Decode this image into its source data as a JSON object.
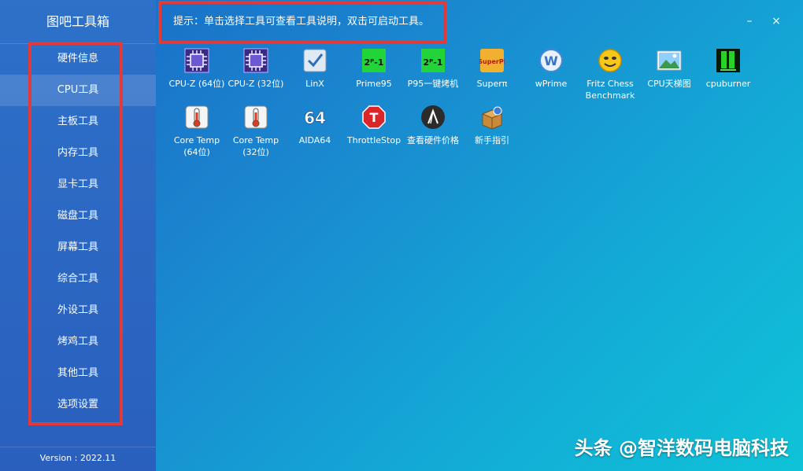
{
  "app": {
    "title": "图吧工具箱",
    "version": "Version : 2022.11"
  },
  "sidebar": {
    "items": [
      {
        "label": "硬件信息"
      },
      {
        "label": "CPU工具"
      },
      {
        "label": "主板工具"
      },
      {
        "label": "内存工具"
      },
      {
        "label": "显卡工具"
      },
      {
        "label": "磁盘工具"
      },
      {
        "label": "屏幕工具"
      },
      {
        "label": "综合工具"
      },
      {
        "label": "外设工具"
      },
      {
        "label": "烤鸡工具"
      },
      {
        "label": "其他工具"
      },
      {
        "label": "选项设置"
      }
    ],
    "active": "CPU工具"
  },
  "tip": {
    "text": "提示：单击选择工具可查看工具说明，双击可启动工具。"
  },
  "window": {
    "minimize_label": "–",
    "close_label": "×"
  },
  "tools": {
    "row1": [
      {
        "label": "CPU-Z (64位)",
        "icon": "cpu-chip-icon"
      },
      {
        "label": "CPU-Z (32位)",
        "icon": "cpu-chip-icon"
      },
      {
        "label": "LinX",
        "icon": "checkmark-icon"
      },
      {
        "label": "Prime95",
        "icon": "prime95-icon"
      },
      {
        "label": "P95一键烤机",
        "icon": "prime95-icon"
      },
      {
        "label": "Superπ",
        "icon": "superpi-icon"
      },
      {
        "label": "wPrime",
        "icon": "wprime-icon"
      },
      {
        "label": "Fritz Chess Benchmark",
        "icon": "smiley-face-icon"
      },
      {
        "label": "CPU天梯图",
        "icon": "landscape-image-icon"
      },
      {
        "label": "cpuburner",
        "icon": "cpuburner-icon"
      }
    ],
    "row2": [
      {
        "label": "Core Temp (64位)",
        "icon": "thermometer-icon"
      },
      {
        "label": "Core Temp (32位)",
        "icon": "thermometer-icon"
      },
      {
        "label": "AIDA64",
        "icon": "aida64-icon"
      },
      {
        "label": "ThrottleStop",
        "icon": "stop-sign-icon"
      },
      {
        "label": "查看硬件价格",
        "icon": "price-lookup-icon"
      },
      {
        "label": "新手指引",
        "icon": "package-guide-icon"
      }
    ],
    "glyphs": {
      "prime": "2ᴾ-1",
      "superpi": "SuperPI",
      "wprime": "W",
      "aida": "64",
      "stop": "T",
      "price": "/\\"
    }
  },
  "watermark": {
    "text": "头条 @智洋数码电脑科技"
  },
  "colors": {
    "highlight_border": "#e03a3a"
  }
}
